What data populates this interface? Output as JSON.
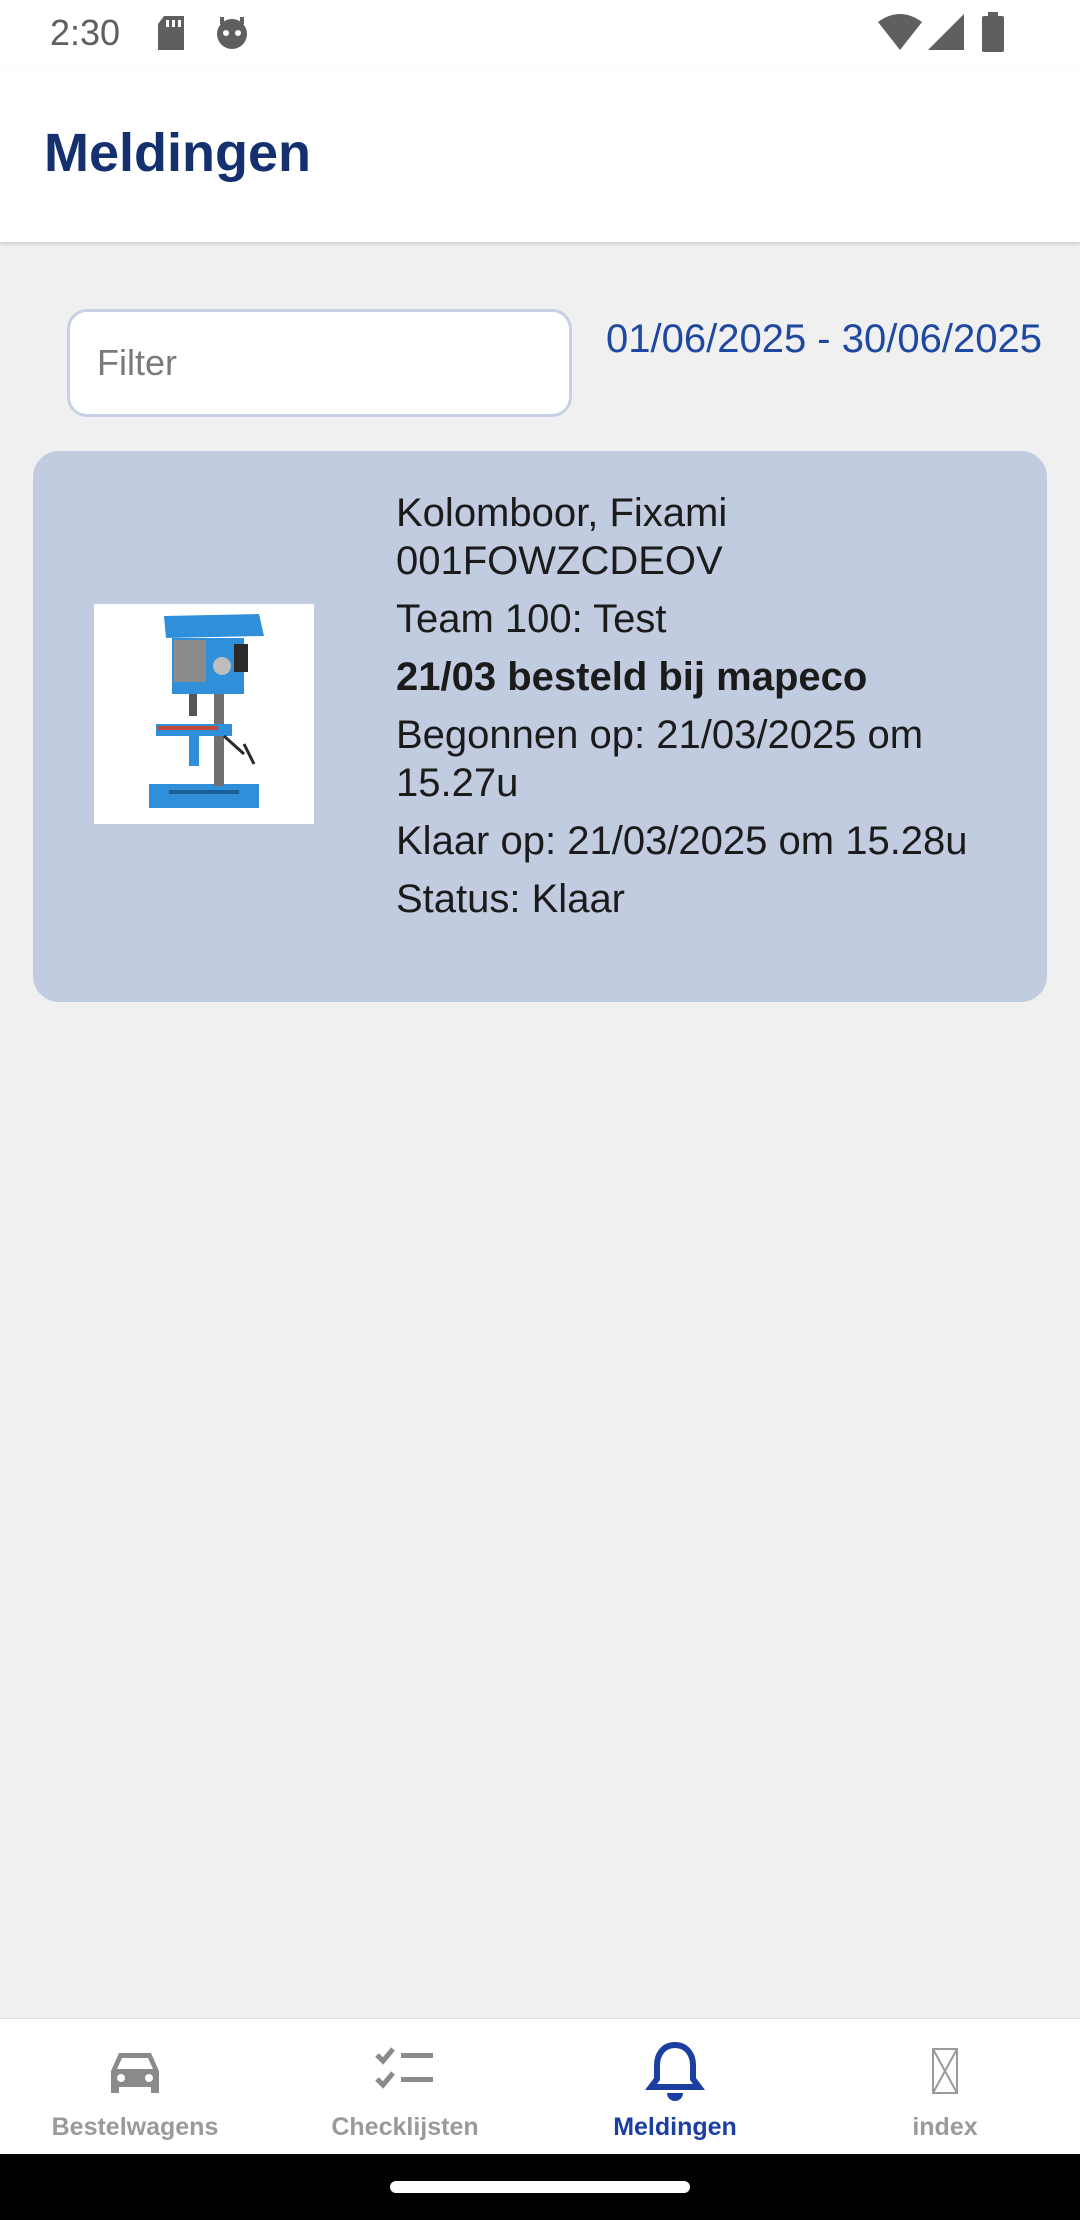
{
  "status_bar": {
    "time": "2:30",
    "left_icons": [
      "sd-card-icon",
      "robot-face-icon"
    ],
    "right_icons": [
      "wifi-icon",
      "cellular-signal-icon",
      "battery-icon"
    ]
  },
  "app_bar": {
    "title": "Meldingen"
  },
  "filter": {
    "placeholder": "Filter",
    "value": ""
  },
  "date_range": "01/06/2025 - 30/06/2025",
  "notifications": [
    {
      "image": "drill-press-icon",
      "name": "Kolomboor, Fixami",
      "code": "001FOWZCDEOV",
      "team": "Team 100: Test",
      "remark": "21/03 besteld bij mapeco",
      "started": "Begonnen op: 21/03/2025 om 15.27u",
      "finished": "Klaar op: 21/03/2025 om 15.28u",
      "status": "Status: Klaar"
    }
  ],
  "bottom_nav": {
    "items": [
      {
        "label": "Bestelwagens",
        "icon": "car-icon",
        "active": false
      },
      {
        "label": "Checklijsten",
        "icon": "checklist-icon",
        "active": false
      },
      {
        "label": "Meldingen",
        "icon": "bell-icon",
        "active": true
      },
      {
        "label": "index",
        "icon": "missing-glyph-icon",
        "active": false
      }
    ]
  },
  "colors": {
    "primary": "#15306f",
    "accent": "#1f48a0",
    "card_background": "#c1cce1",
    "page_background": "#f0f0f0",
    "inactive": "#9a9a9a"
  }
}
